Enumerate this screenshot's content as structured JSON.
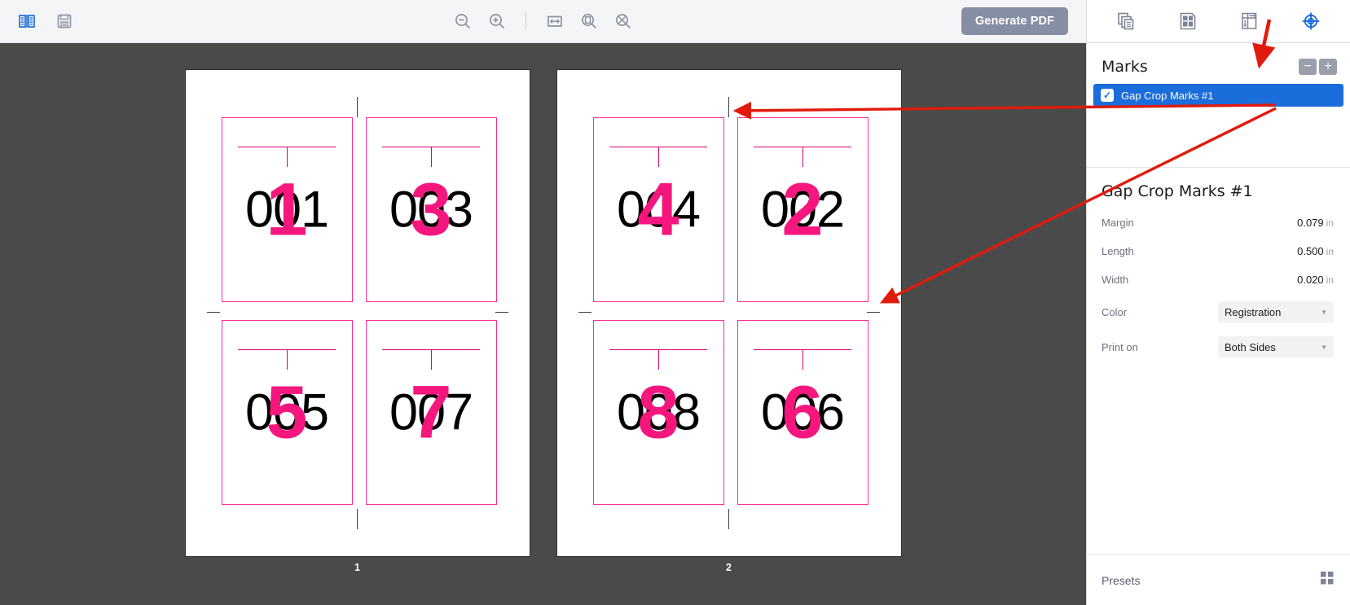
{
  "toolbar": {
    "left_icons": [
      {
        "name": "two-page-spread-icon",
        "label": "Two Page View"
      },
      {
        "name": "save-icon",
        "label": "Save"
      }
    ],
    "center_icons": [
      {
        "name": "zoom-out-icon",
        "label": "Zoom Out"
      },
      {
        "name": "zoom-in-icon",
        "label": "Zoom In"
      },
      {
        "name": "fit-width-icon",
        "label": "Fit Width"
      },
      {
        "name": "fit-page-icon",
        "label": "Fit Page"
      },
      {
        "name": "actual-size-icon",
        "label": "Actual Size"
      }
    ],
    "generate_pdf_label": "Generate PDF"
  },
  "canvas": {
    "sheets": [
      {
        "label": "1",
        "cards": [
          {
            "black": "001",
            "pink": "1"
          },
          {
            "black": "003",
            "pink": "3"
          },
          {
            "black": "005",
            "pink": "5"
          },
          {
            "black": "007",
            "pink": "7"
          }
        ]
      },
      {
        "label": "2",
        "cards": [
          {
            "black": "004",
            "pink": "4"
          },
          {
            "black": "002",
            "pink": "2"
          },
          {
            "black": "008",
            "pink": "8"
          },
          {
            "black": "006",
            "pink": "6"
          }
        ]
      }
    ],
    "colors": {
      "sheet_background": "#ffffff",
      "canvas_background": "#4a4a4a",
      "card_outline": "#ff2d96",
      "card_rule": "#d6006e",
      "pink_number": "#f5167e",
      "black_number": "#000000",
      "crop_mark": "#3b3b3b"
    }
  },
  "right_panel": {
    "tabs": [
      {
        "name": "pages-icon",
        "label": "Pages",
        "active": false
      },
      {
        "name": "grid-layout-icon",
        "label": "Layout",
        "active": false
      },
      {
        "name": "imposition-flow-icon",
        "label": "Imposition",
        "active": false
      },
      {
        "name": "registration-target-icon",
        "label": "Marks",
        "active": true
      }
    ],
    "marks_section": {
      "title": "Marks",
      "remove_label": "−",
      "add_label": "+",
      "items": [
        {
          "label": "Gap Crop Marks #1",
          "checked": true,
          "selected": true
        }
      ]
    },
    "properties": {
      "title": "Gap Crop Marks #1",
      "rows": [
        {
          "label": "Margin",
          "value": "0.079",
          "unit": "in",
          "type": "number"
        },
        {
          "label": "Length",
          "value": "0.500",
          "unit": "in",
          "type": "number"
        },
        {
          "label": "Width",
          "value": "0.020",
          "unit": "in",
          "type": "number"
        }
      ],
      "selects": [
        {
          "label": "Color",
          "value": "Registration"
        },
        {
          "label": "Print on",
          "value": "Both Sides"
        }
      ]
    },
    "presets": {
      "label": "Presets",
      "icon": "presets-grid-icon"
    }
  },
  "annotations": {
    "arrow_color": "#e01b0d",
    "arrows": [
      {
        "name": "arrow-to-add-mark-button"
      },
      {
        "name": "arrow-to-gap-crop-mark-top"
      },
      {
        "name": "arrow-to-gap-crop-mark-bottom"
      }
    ]
  }
}
